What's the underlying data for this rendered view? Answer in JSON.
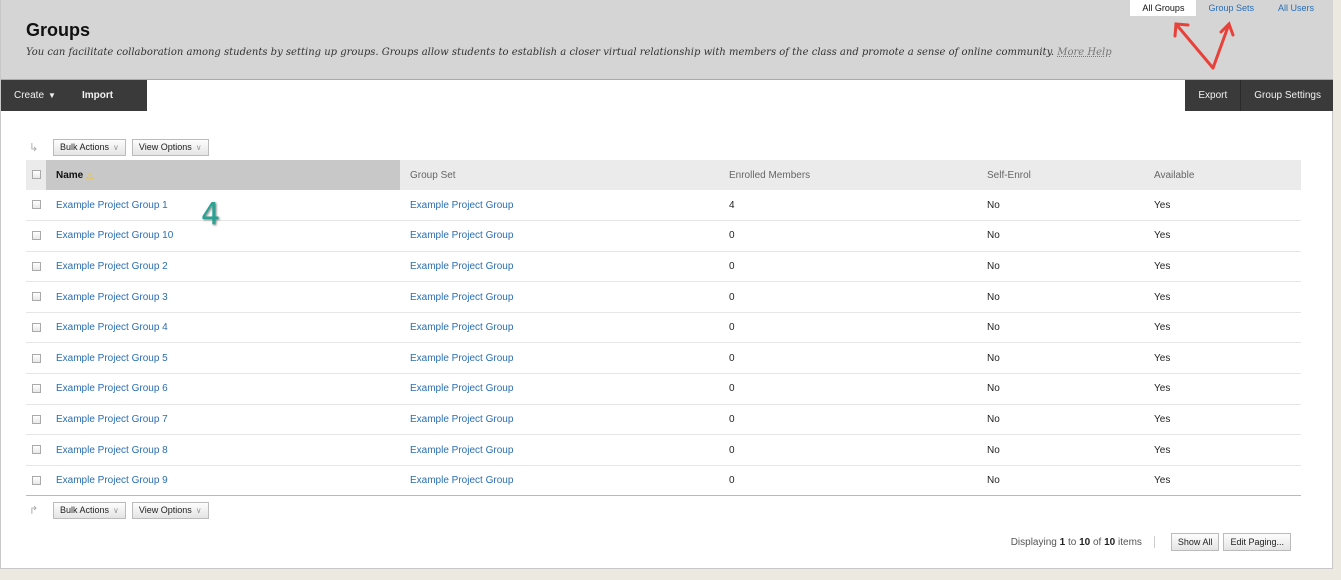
{
  "header": {
    "title": "Groups",
    "description": "You can facilitate collaboration among students by setting up groups. Groups allow students to establish a closer virtual relationship with members of the class and promote a sense of online community.",
    "help_link": "More Help"
  },
  "top_tabs": [
    "All Groups",
    "Group Sets",
    "All Users"
  ],
  "toolbar": {
    "create_label": "Create",
    "import_label": "Import",
    "export_label": "Export",
    "group_settings_label": "Group Settings"
  },
  "action_bar": {
    "bulk_actions_label": "Bulk Actions",
    "view_options_label": "View Options"
  },
  "table": {
    "columns": [
      "Name",
      "Group Set",
      "Enrolled Members",
      "Self-Enrol",
      "Available"
    ],
    "rows": [
      {
        "name": "Example Project Group 1",
        "group_set": "Example Project Group",
        "enrolled": "4",
        "self_enrol": "No",
        "available": "Yes"
      },
      {
        "name": "Example Project Group 10",
        "group_set": "Example Project Group",
        "enrolled": "0",
        "self_enrol": "No",
        "available": "Yes"
      },
      {
        "name": "Example Project Group 2",
        "group_set": "Example Project Group",
        "enrolled": "0",
        "self_enrol": "No",
        "available": "Yes"
      },
      {
        "name": "Example Project Group 3",
        "group_set": "Example Project Group",
        "enrolled": "0",
        "self_enrol": "No",
        "available": "Yes"
      },
      {
        "name": "Example Project Group 4",
        "group_set": "Example Project Group",
        "enrolled": "0",
        "self_enrol": "No",
        "available": "Yes"
      },
      {
        "name": "Example Project Group 5",
        "group_set": "Example Project Group",
        "enrolled": "0",
        "self_enrol": "No",
        "available": "Yes"
      },
      {
        "name": "Example Project Group 6",
        "group_set": "Example Project Group",
        "enrolled": "0",
        "self_enrol": "No",
        "available": "Yes"
      },
      {
        "name": "Example Project Group 7",
        "group_set": "Example Project Group",
        "enrolled": "0",
        "self_enrol": "No",
        "available": "Yes"
      },
      {
        "name": "Example Project Group 8",
        "group_set": "Example Project Group",
        "enrolled": "0",
        "self_enrol": "No",
        "available": "Yes"
      },
      {
        "name": "Example Project Group 9",
        "group_set": "Example Project Group",
        "enrolled": "0",
        "self_enrol": "No",
        "available": "Yes"
      }
    ]
  },
  "annotation": "4",
  "pager": {
    "prefix": "Displaying",
    "from": "1",
    "to_word": "to",
    "to": "10",
    "of_word": "of",
    "total": "10",
    "suffix": "items",
    "show_all_label": "Show All",
    "edit_paging_label": "Edit Paging..."
  },
  "colors": {
    "link": "#2a6eb3",
    "toolbar_bg": "#3a3a3a",
    "header_bg": "#d5d5d5",
    "arrow_annotation": "#e8413a",
    "number_annotation": "#2aa192"
  }
}
